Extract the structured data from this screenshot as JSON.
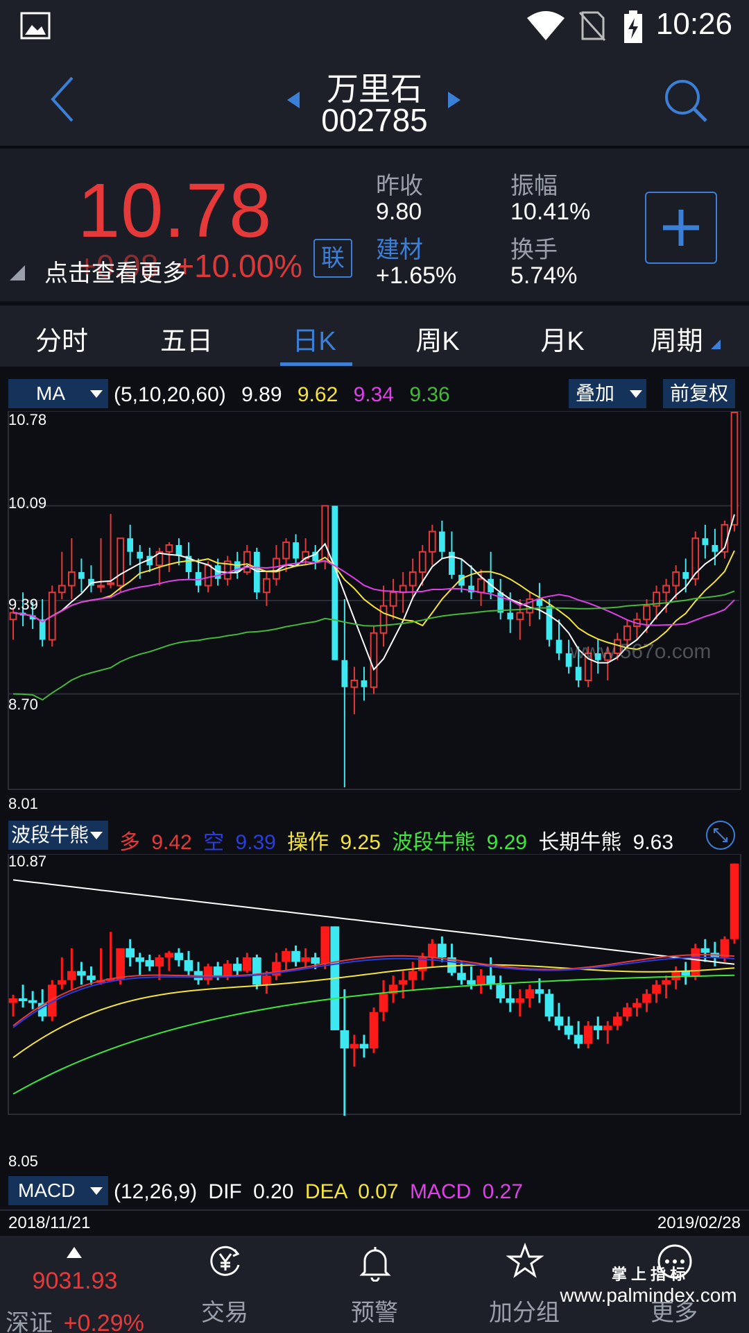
{
  "status": {
    "time": "10:26"
  },
  "stock": {
    "name": "万里石",
    "code": "002785"
  },
  "quote": {
    "price": "10.78",
    "change": "+0.98",
    "change_pct": "+10.00%",
    "more_tip": "点击查看更多",
    "lian": "联",
    "prev_close_label": "昨收",
    "prev_close": "9.80",
    "amplitude_label": "振幅",
    "amplitude": "10.41%",
    "sector_label": "建材",
    "sector_change": "+1.65%",
    "turnover_label": "换手",
    "turnover": "5.74%"
  },
  "tabs": [
    "分时",
    "五日",
    "日K",
    "周K",
    "月K",
    "周期"
  ],
  "active_tab": "日K",
  "main_indicator": {
    "name": "MA",
    "params": "(5,10,20,60)",
    "ma5": "9.89",
    "ma10": "9.62",
    "ma20": "9.34",
    "ma60": "9.36",
    "overlay_label": "叠加",
    "adjust_label": "前复权",
    "axis": [
      "10.78",
      "10.09",
      "9.39",
      "8.70",
      "8.01"
    ],
    "watermark": "www.567o.com"
  },
  "sub_indicator": {
    "name": "波段牛熊",
    "duo_label": "多",
    "duo": "9.42",
    "kong_label": "空",
    "kong": "9.39",
    "op_label": "操作",
    "op": "9.25",
    "bd_label": "波段牛熊",
    "bd": "9.29",
    "long_label": "长期牛熊",
    "long": "9.63",
    "axis_top": "10.87",
    "axis_bottom": "8.05"
  },
  "macd": {
    "name": "MACD",
    "params": "(12,26,9)",
    "dif_label": "DIF",
    "dif": "0.20",
    "dea_label": "DEA",
    "dea": "0.07",
    "macd_label": "MACD",
    "macd": "0.27"
  },
  "dates": {
    "start": "2018/11/21",
    "end": "2019/02/28"
  },
  "bottom_nav": {
    "index_value": "9031.93",
    "index_name": "深证",
    "index_change": "+0.29%",
    "items": [
      "交易",
      "预警",
      "加分组",
      "更多"
    ]
  },
  "watermark_bottom": {
    "top": "掌 上 指 标",
    "url": "www.palmindex.com"
  },
  "colors": {
    "up": "#e63a3a",
    "down": "#3ee8f0",
    "accent": "#3b7fd6"
  },
  "chart_data": {
    "type": "candlestick",
    "ylim": [
      8.01,
      10.78
    ],
    "candles": [
      [
        9.25,
        9.34,
        9.1,
        9.3
      ],
      [
        9.3,
        9.45,
        9.2,
        9.28
      ],
      [
        9.28,
        9.38,
        9.18,
        9.25
      ],
      [
        9.25,
        9.4,
        9.05,
        9.1
      ],
      [
        9.1,
        9.5,
        9.05,
        9.45
      ],
      [
        9.45,
        9.75,
        9.4,
        9.5
      ],
      [
        9.5,
        9.85,
        9.4,
        9.6
      ],
      [
        9.6,
        9.7,
        9.45,
        9.55
      ],
      [
        9.55,
        9.65,
        9.45,
        9.5
      ],
      [
        9.5,
        9.85,
        9.45,
        9.5
      ],
      [
        9.52,
        10.03,
        9.48,
        9.52
      ],
      [
        9.5,
        9.8,
        9.45,
        9.85
      ],
      [
        9.85,
        9.95,
        9.65,
        9.75
      ],
      [
        9.75,
        9.8,
        9.55,
        9.7
      ],
      [
        9.72,
        9.78,
        9.6,
        9.65
      ],
      [
        9.65,
        9.78,
        9.5,
        9.75
      ],
      [
        9.75,
        9.82,
        9.6,
        9.8
      ],
      [
        9.8,
        9.85,
        9.65,
        9.72
      ],
      [
        9.72,
        9.82,
        9.55,
        9.6
      ],
      [
        9.6,
        9.7,
        9.45,
        9.5
      ],
      [
        9.5,
        9.68,
        9.45,
        9.65
      ],
      [
        9.65,
        9.7,
        9.5,
        9.55
      ],
      [
        9.55,
        9.72,
        9.5,
        9.68
      ],
      [
        9.68,
        9.75,
        9.55,
        9.6
      ],
      [
        9.6,
        9.8,
        9.58,
        9.75
      ],
      [
        9.75,
        9.78,
        9.4,
        9.45
      ],
      [
        9.45,
        9.6,
        9.35,
        9.55
      ],
      [
        9.55,
        9.8,
        9.5,
        9.7
      ],
      [
        9.7,
        9.85,
        9.6,
        9.82
      ],
      [
        9.82,
        9.88,
        9.65,
        9.7
      ],
      [
        9.7,
        9.85,
        9.65,
        9.75
      ],
      [
        9.75,
        9.8,
        9.62,
        9.68
      ],
      [
        9.68,
        10.09,
        9.62,
        10.09
      ],
      [
        10.09,
        10.09,
        8.95,
        8.95
      ],
      [
        8.95,
        9.4,
        8.01,
        8.75
      ],
      [
        8.75,
        8.9,
        8.55,
        8.8
      ],
      [
        8.8,
        8.9,
        8.65,
        8.75
      ],
      [
        8.75,
        9.2,
        8.7,
        9.15
      ],
      [
        9.15,
        9.5,
        9.05,
        9.35
      ],
      [
        9.35,
        9.55,
        9.25,
        9.45
      ],
      [
        9.45,
        9.6,
        9.3,
        9.5
      ],
      [
        9.5,
        9.7,
        9.4,
        9.6
      ],
      [
        9.6,
        9.8,
        9.5,
        9.75
      ],
      [
        9.75,
        9.95,
        9.65,
        9.9
      ],
      [
        9.9,
        9.98,
        9.7,
        9.75
      ],
      [
        9.75,
        9.9,
        9.55,
        9.58
      ],
      [
        9.58,
        9.7,
        9.45,
        9.5
      ],
      [
        9.5,
        9.65,
        9.4,
        9.45
      ],
      [
        9.45,
        9.62,
        9.35,
        9.55
      ],
      [
        9.55,
        9.75,
        9.4,
        9.45
      ],
      [
        9.45,
        9.55,
        9.25,
        9.3
      ],
      [
        9.3,
        9.45,
        9.15,
        9.25
      ],
      [
        9.25,
        9.4,
        9.1,
        9.3
      ],
      [
        9.3,
        9.45,
        9.2,
        9.4
      ],
      [
        9.4,
        9.52,
        9.25,
        9.35
      ],
      [
        9.35,
        9.4,
        9.05,
        9.1
      ],
      [
        9.1,
        9.25,
        8.95,
        9.0
      ],
      [
        9.0,
        9.1,
        8.85,
        8.9
      ],
      [
        8.9,
        9.05,
        8.75,
        8.8
      ],
      [
        8.8,
        9.05,
        8.75,
        9.0
      ],
      [
        9.0,
        9.1,
        8.85,
        8.95
      ],
      [
        8.95,
        9.05,
        8.8,
        9.0
      ],
      [
        9.0,
        9.15,
        8.95,
        9.1
      ],
      [
        9.1,
        9.25,
        9.05,
        9.2
      ],
      [
        9.2,
        9.3,
        9.1,
        9.25
      ],
      [
        9.25,
        9.4,
        9.15,
        9.35
      ],
      [
        9.35,
        9.5,
        9.25,
        9.45
      ],
      [
        9.45,
        9.55,
        9.3,
        9.5
      ],
      [
        9.5,
        9.65,
        9.4,
        9.6
      ],
      [
        9.6,
        9.7,
        9.45,
        9.55
      ],
      [
        9.55,
        9.9,
        9.5,
        9.85
      ],
      [
        9.85,
        9.95,
        9.7,
        9.8
      ],
      [
        9.8,
        9.92,
        9.65,
        9.75
      ],
      [
        9.75,
        9.98,
        9.7,
        9.95
      ],
      [
        9.95,
        10.78,
        9.9,
        10.78
      ]
    ]
  }
}
